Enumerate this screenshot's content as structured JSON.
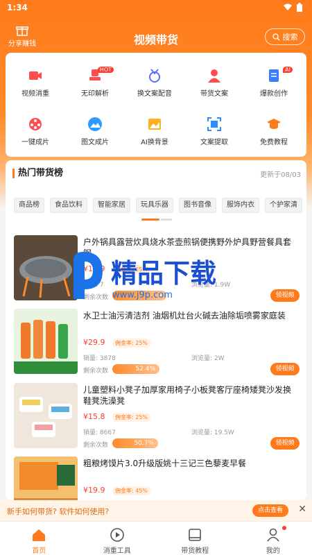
{
  "status_bar": {
    "time": "1:34"
  },
  "header": {
    "share_label": "分享赚钱",
    "title": "视频带货",
    "search_label": "搜索"
  },
  "tools": [
    {
      "label": "视频消重",
      "icon": "video-icon",
      "color": "#ff4d4f"
    },
    {
      "label": "无印解析",
      "icon": "stamp-icon",
      "color": "#ff4d4f",
      "badge": "HOT"
    },
    {
      "label": "换文案配音",
      "icon": "medal-icon",
      "color": "#5b6cff"
    },
    {
      "label": "带货文案",
      "icon": "user-icon",
      "color": "#ff4d4f"
    },
    {
      "label": "爆款创作",
      "icon": "document-icon",
      "color": "#3d7bff",
      "badge": "AI"
    },
    {
      "label": "一键成片",
      "icon": "film-reel-icon",
      "color": "#ff4d4f"
    },
    {
      "label": "图文成片",
      "icon": "image-icon",
      "color": "#2d9cff"
    },
    {
      "label": "AI换背景",
      "icon": "picture-icon",
      "color": "#ffb020"
    },
    {
      "label": "文案提取",
      "icon": "scan-icon",
      "color": "#2d8cff"
    },
    {
      "label": "免费教程",
      "icon": "graduation-cap-icon",
      "color": "#ff7a1a"
    }
  ],
  "hot_list": {
    "title": "热门带货榜",
    "updated": "更新于08/03",
    "categories": [
      "商品榜",
      "食品饮料",
      "智能家居",
      "玩具乐器",
      "图书音像",
      "服饰内衣",
      "个护家清"
    ],
    "products": [
      {
        "name": "户外锅具露营炊具烧水茶壶煎锅便携野外炉具野营餐具套钢",
        "price": "¥19.9",
        "commission": "佣金率: 25%",
        "sales": "销量: 7",
        "views": "浏览量: 1.9W",
        "remain_label": "剩余次数",
        "remain": "4",
        "progress": 0.6,
        "cta": "领视频"
      },
      {
        "name": "水卫士油污清洁剂 油烟机灶台火碱去油除垢喷雾家庭装",
        "price": "¥29.9",
        "commission": "佣金率: 25%",
        "sales": "销量: 3878",
        "views": "浏览量: 2W",
        "remain_label": "剩余次数",
        "remain": "52.4%",
        "progress": 0.52,
        "cta": "领视频"
      },
      {
        "name": "儿童塑料小凳子加厚家用椅子小板凳客厅座椅矮凳沙发换鞋凳洗澡凳",
        "price": "¥15.8",
        "commission": "佣金率: 25%",
        "sales": "销量: 8667",
        "views": "浏览量: 19.5W",
        "remain_label": "剩余次数",
        "remain": "50.7%",
        "progress": 0.51,
        "cta": "领视频"
      },
      {
        "name": "粗粮烤馍片3.0升级版姚十三记三色藜麦早餐",
        "price": "¥19.9",
        "commission": "佣金率: 45%",
        "sales": "",
        "views": "",
        "remain_label": "",
        "remain": "",
        "progress": 0.5,
        "cta": ""
      }
    ]
  },
  "watermark": {
    "brand": "精品下载",
    "url": "www.j9p.com"
  },
  "banner": {
    "text": "新手如何带货? 软件如何使用?",
    "cta": "点击查看",
    "close": "✕"
  },
  "bottom_nav": [
    {
      "label": "首页",
      "icon": "home-icon",
      "active": true
    },
    {
      "label": "消重工具",
      "icon": "play-circle-icon",
      "active": false
    },
    {
      "label": "带货教程",
      "icon": "book-icon",
      "active": false
    },
    {
      "label": "我的",
      "icon": "person-icon",
      "active": false
    }
  ]
}
